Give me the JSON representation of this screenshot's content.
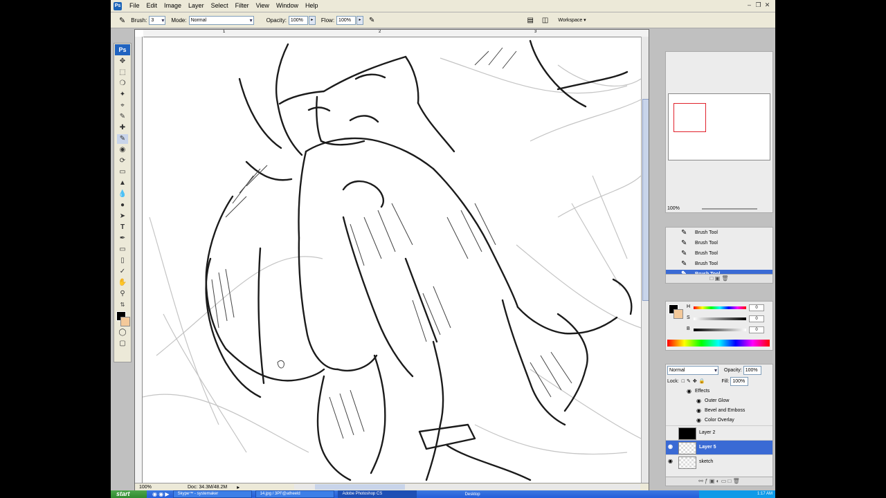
{
  "app": {
    "title": "Adobe Photoshop CS"
  },
  "menubar": {
    "items": [
      "File",
      "Edit",
      "Image",
      "Layer",
      "Select",
      "Filter",
      "View",
      "Window",
      "Help"
    ]
  },
  "options": {
    "brush_label": "Brush:",
    "brush_size": "3",
    "mode_label": "Mode:",
    "mode_value": "Normal",
    "opacity_label": "Opacity:",
    "opacity_value": "100%",
    "flow_label": "Flow:",
    "flow_value": "100%",
    "workspace_label": "Workspace"
  },
  "ruler": {
    "top_ticks": [
      "1",
      "2",
      "3"
    ]
  },
  "canvas": {
    "zoom": "100%",
    "doc_info": "Doc: 34.3M/48.2M"
  },
  "navigator": {
    "zoom": "100%"
  },
  "history": {
    "items": [
      "Brush Tool",
      "Brush Tool",
      "Brush Tool",
      "Brush Tool",
      "Brush Tool"
    ],
    "selected_index": 4
  },
  "color": {
    "labels": [
      "H",
      "S",
      "B"
    ],
    "values": [
      "0",
      "0",
      "0"
    ],
    "foreground": "#000000",
    "background": "#f4c99a"
  },
  "layers": {
    "blend_mode": "Normal",
    "opacity_label": "Opacity:",
    "opacity_value": "100%",
    "lock_label": "Lock:",
    "fill_label": "Fill:",
    "fill_value": "100%",
    "effects_label": "Effects",
    "effects": [
      "Outer Glow",
      "Bevel and Emboss",
      "Color Overlay"
    ],
    "list": [
      {
        "name": "Layer 2",
        "thumb": "#000000"
      },
      {
        "name": "Layer 5",
        "thumb": "#ffffff"
      },
      {
        "name": "sketch",
        "thumb": "#f6f6f6"
      }
    ],
    "selected_index": 1
  },
  "taskbar": {
    "start_label": "start",
    "tasks": [
      "Skype™ - systemaker",
      "14.jpg / 3PF@atheeld",
      "Adobe Photoshop CS"
    ],
    "tray_label": "Desktop",
    "time": "1:17 AM"
  }
}
